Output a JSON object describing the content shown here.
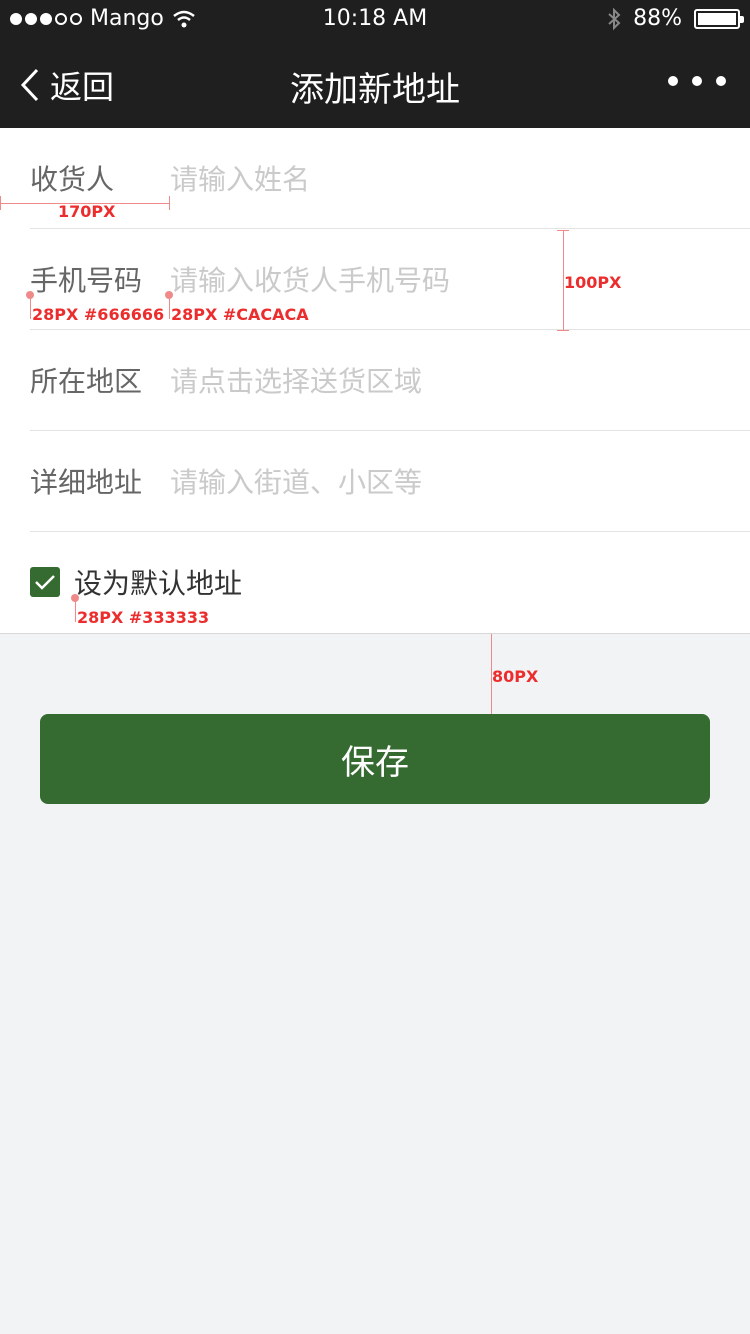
{
  "status_bar": {
    "carrier": "Mango",
    "time": "10:18 AM",
    "battery": "88%",
    "signal_icon": "signal-dots-icon",
    "wifi_icon": "wifi-icon",
    "bluetooth_icon": "bluetooth-icon",
    "battery_level": 0.88
  },
  "nav": {
    "back_label": "返回",
    "title": "添加新地址",
    "more_icon": "more-icon"
  },
  "form": {
    "rows": [
      {
        "label": "收货人",
        "placeholder": "请输入姓名"
      },
      {
        "label": "手机号码",
        "placeholder": "请输入收货人手机号码"
      },
      {
        "label": "所在地区",
        "placeholder": "请点击选择送货区域"
      },
      {
        "label": "详细地址",
        "placeholder": "请输入街道、小区等"
      }
    ],
    "default_label": "设为默认地址",
    "default_checked": true
  },
  "save_label": "保存",
  "annotations": {
    "label_width": "170PX",
    "row_height": "100PX",
    "label_style": "28PX #666666",
    "placeholder_style": "28PX #CACACA",
    "checkbox_text_style": "28PX #333333",
    "button_gap": "80PX"
  },
  "colors": {
    "nav_bg": "#1f1f20",
    "accent": "#356a31",
    "label": "#666666",
    "placeholder": "#cacaca",
    "text": "#333333",
    "page_bg": "#f2f3f5"
  }
}
